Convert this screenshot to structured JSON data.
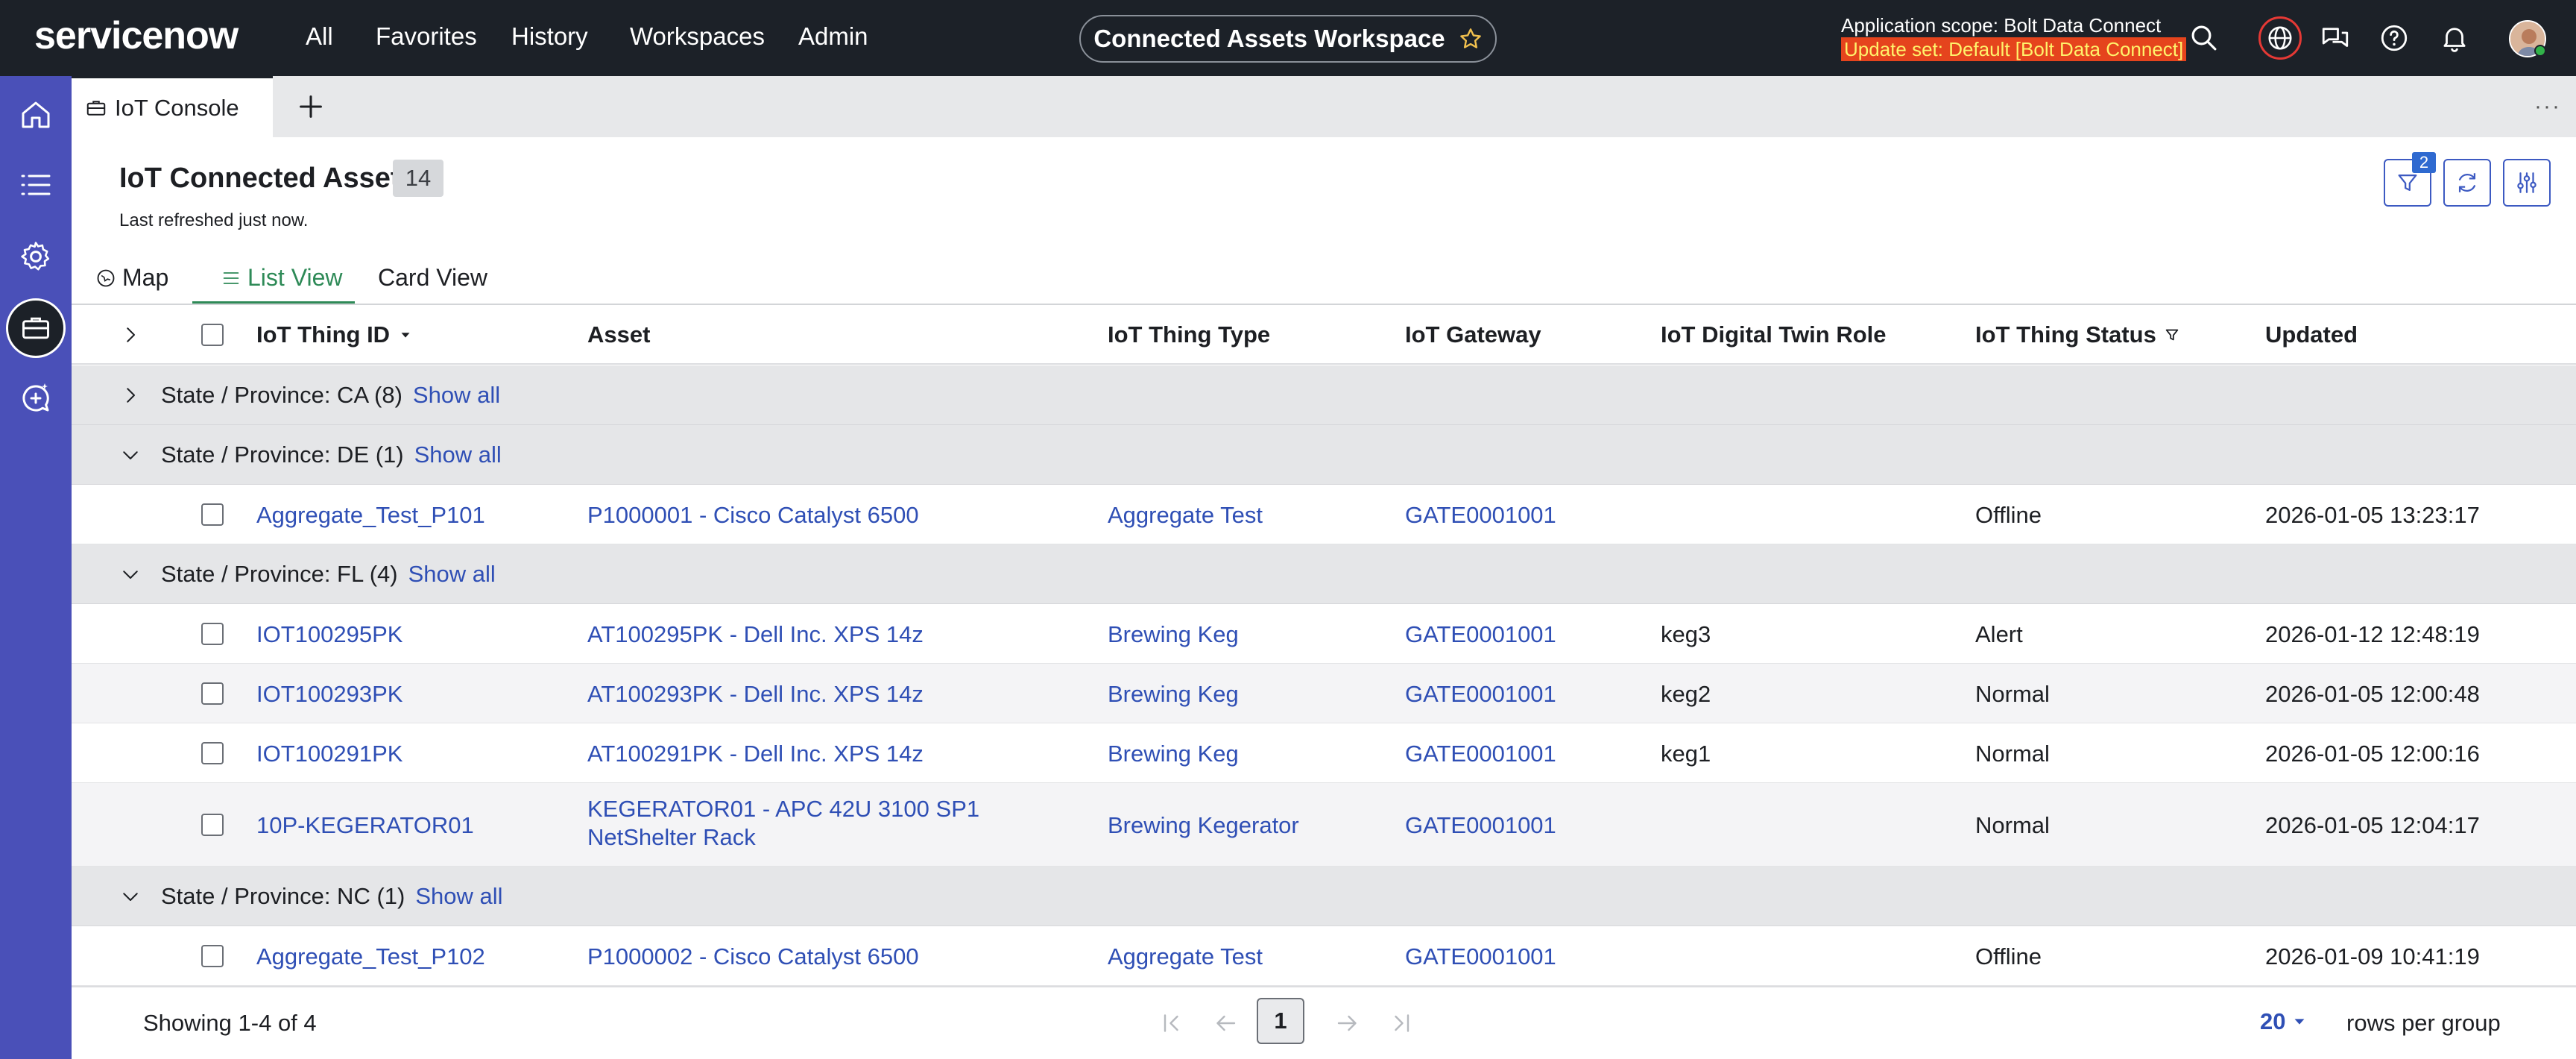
{
  "nav": {
    "logo": "servicenow",
    "links": [
      "All",
      "Favorites",
      "History",
      "Workspaces",
      "Admin"
    ],
    "workspace": "Connected Assets Workspace",
    "scope_label": "Application scope: Bolt Data Connect",
    "update_set": "Update set: Default [Bolt Data Connect]"
  },
  "tabs": {
    "active_label": "IoT Console"
  },
  "header": {
    "title": "IoT Connected Asset",
    "count": "14",
    "refreshed": "Last refreshed just now.",
    "filter_count": "2"
  },
  "views": [
    "Map",
    "List View",
    "Card View"
  ],
  "columns": [
    "IoT Thing ID",
    "Asset",
    "IoT Thing Type",
    "IoT Gateway",
    "IoT Digital Twin Role",
    "IoT Thing Status",
    "Updated"
  ],
  "show_all": "Show all",
  "groups": [
    {
      "label": "State / Province: CA (8)"
    },
    {
      "label": "State / Province: DE (1)"
    },
    {
      "label": "State / Province: FL (4)"
    },
    {
      "label": "State / Province: NC (1)"
    }
  ],
  "rows": [
    {
      "id": "Aggregate_Test_P101",
      "asset": "P1000001 - Cisco Catalyst 6500",
      "type": "Aggregate Test",
      "gateway": "GATE0001001",
      "role": "",
      "status": "Offline",
      "updated": "2026-01-05 13:23:17"
    },
    {
      "id": "IOT100295PK",
      "asset": "AT100295PK - Dell Inc. XPS 14z",
      "type": "Brewing Keg",
      "gateway": "GATE0001001",
      "role": "keg3",
      "status": "Alert",
      "updated": "2026-01-12 12:48:19"
    },
    {
      "id": "IOT100293PK",
      "asset": "AT100293PK - Dell Inc. XPS 14z",
      "type": "Brewing Keg",
      "gateway": "GATE0001001",
      "role": "keg2",
      "status": "Normal",
      "updated": "2026-01-05 12:00:48"
    },
    {
      "id": "IOT100291PK",
      "asset": "AT100291PK - Dell Inc. XPS 14z",
      "type": "Brewing Keg",
      "gateway": "GATE0001001",
      "role": "keg1",
      "status": "Normal",
      "updated": "2026-01-05 12:00:16"
    },
    {
      "id": "10P-KEGERATOR01",
      "asset_line1": "KEGERATOR01 - APC 42U 3100 SP1",
      "asset_line2": "NetShelter Rack",
      "type": "Brewing Kegerator",
      "gateway": "GATE0001001",
      "role": "",
      "status": "Normal",
      "updated": "2026-01-05 12:04:17"
    },
    {
      "id": "Aggregate_Test_P102",
      "asset": "P1000002 - Cisco Catalyst 6500",
      "type": "Aggregate Test",
      "gateway": "GATE0001001",
      "role": "",
      "status": "Offline",
      "updated": "2026-01-09 10:41:19"
    }
  ],
  "footer": {
    "showing": "Showing 1-4 of 4",
    "page": "1",
    "rows_per_group": "20",
    "rows_label": "rows per group"
  }
}
